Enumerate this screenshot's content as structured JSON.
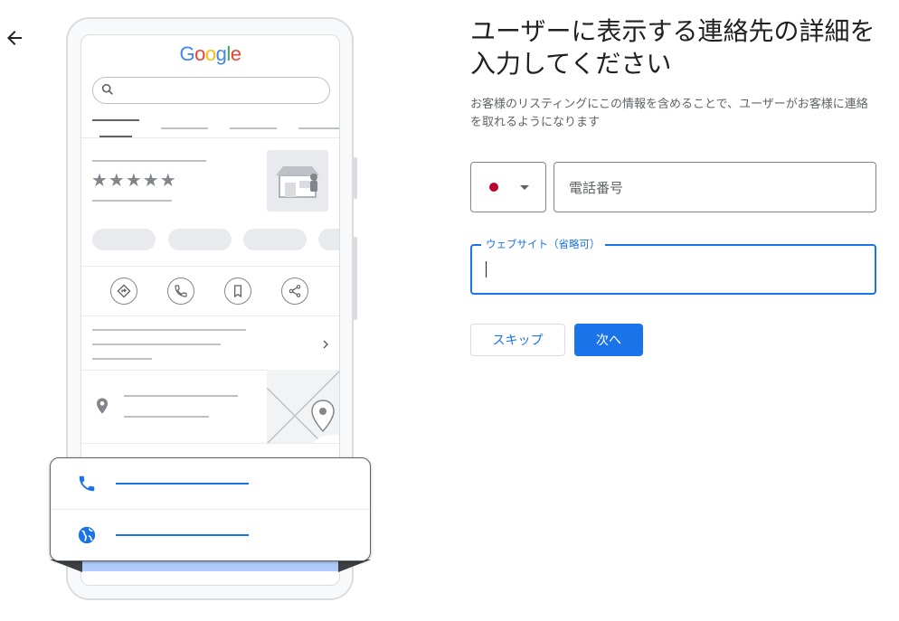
{
  "header": {
    "back_icon": "arrow-back-icon",
    "title": "ユーザーに表示する連絡先の詳細を入力してください",
    "description": "お客様のリスティングにこの情報を含めることで、ユーザーがお客様に連絡を取れるようになります"
  },
  "illustration": {
    "logo": {
      "letters": [
        "G",
        "o",
        "o",
        "g",
        "l",
        "e"
      ],
      "colors": [
        "#4285f4",
        "#ea4335",
        "#fbbc05",
        "#4285f4",
        "#34a853",
        "#ea4335"
      ]
    },
    "stars": "★★★★★",
    "action_icons": [
      "directions-icon",
      "phone-icon",
      "bookmark-icon",
      "share-icon"
    ],
    "card_icons": [
      "phone-icon",
      "globe-icon"
    ],
    "accent_color": "#1a73e8"
  },
  "form": {
    "country_flag": "japan-flag-icon",
    "phone_placeholder": "電話番号",
    "phone_value": "",
    "website_label": "ウェブサイト（省略可）",
    "website_value": ""
  },
  "buttons": {
    "skip_label": "スキップ",
    "next_label": "次へ"
  },
  "colors": {
    "primary": "#1a73e8",
    "flag_red": "#bc002d"
  }
}
